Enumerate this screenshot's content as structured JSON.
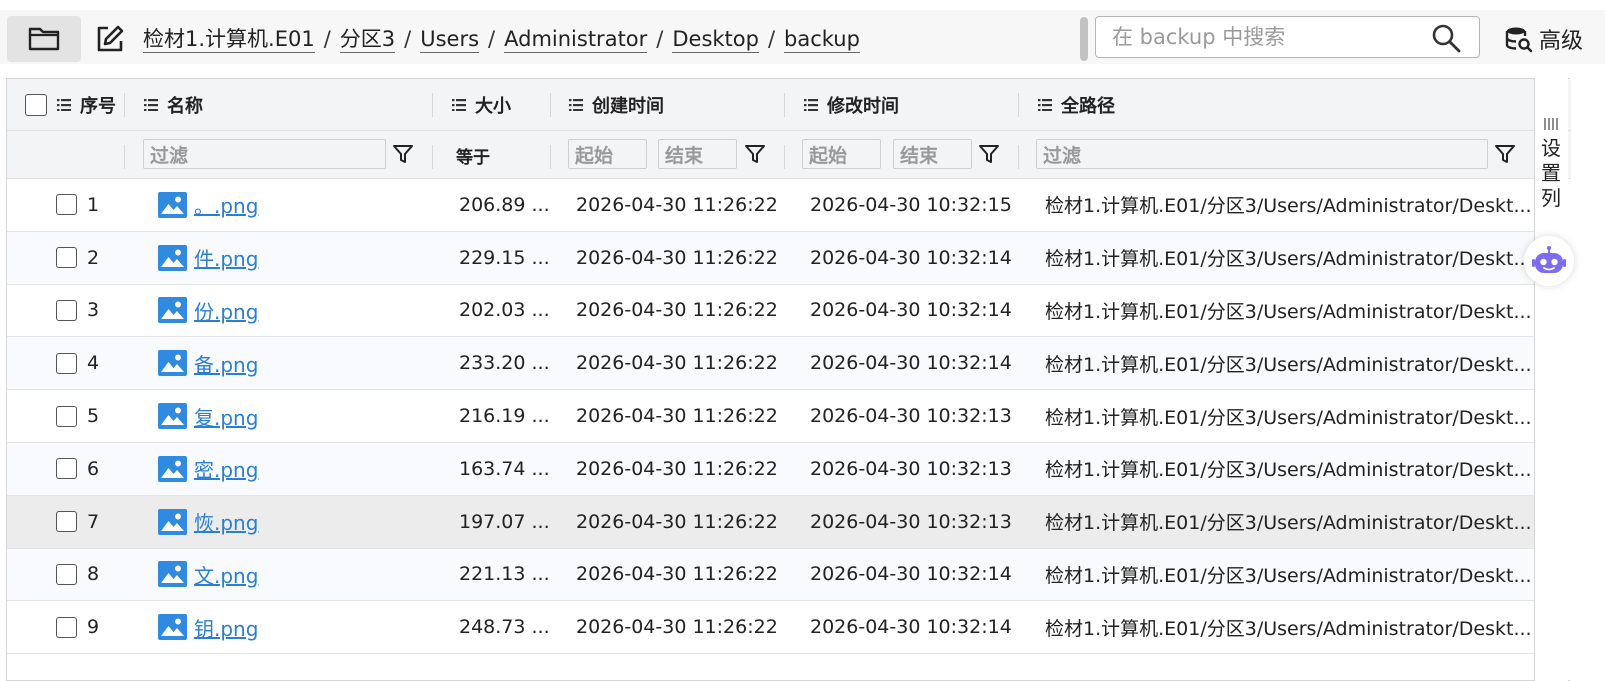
{
  "breadcrumb": [
    "检材1.计算机.E01",
    "分区3",
    "Users",
    "Administrator",
    "Desktop",
    "backup"
  ],
  "breadcrumb_separator": "/",
  "search": {
    "placeholder": "在 backup 中搜索"
  },
  "advanced_label": "高级",
  "columns": {
    "index": "序号",
    "name": "名称",
    "size": "大小",
    "created": "创建时间",
    "modified": "修改时间",
    "fullpath": "全路径"
  },
  "filters": {
    "name_placeholder": "过滤",
    "size_operator": "等于",
    "created_start": "起始",
    "created_end": "结束",
    "modified_start": "起始",
    "modified_end": "结束",
    "fullpath_placeholder": "过滤"
  },
  "rows": [
    {
      "index": "1",
      "name": "。.png",
      "size": "206.89 ...",
      "created": "2026-04-30 11:26:22",
      "modified": "2026-04-30 10:32:15",
      "fullpath": "检材1.计算机.E01/分区3/Users/Administrator/Deskt..."
    },
    {
      "index": "2",
      "name": "件.png",
      "size": "229.15 ...",
      "created": "2026-04-30 11:26:22",
      "modified": "2026-04-30 10:32:14",
      "fullpath": "检材1.计算机.E01/分区3/Users/Administrator/Deskt..."
    },
    {
      "index": "3",
      "name": "份.png",
      "size": "202.03 ...",
      "created": "2026-04-30 11:26:22",
      "modified": "2026-04-30 10:32:14",
      "fullpath": "检材1.计算机.E01/分区3/Users/Administrator/Deskt..."
    },
    {
      "index": "4",
      "name": "备.png",
      "size": "233.20 ...",
      "created": "2026-04-30 11:26:22",
      "modified": "2026-04-30 10:32:14",
      "fullpath": "检材1.计算机.E01/分区3/Users/Administrator/Deskt..."
    },
    {
      "index": "5",
      "name": "复.png",
      "size": "216.19 ...",
      "created": "2026-04-30 11:26:22",
      "modified": "2026-04-30 10:32:13",
      "fullpath": "检材1.计算机.E01/分区3/Users/Administrator/Deskt..."
    },
    {
      "index": "6",
      "name": "密.png",
      "size": "163.74 ...",
      "created": "2026-04-30 11:26:22",
      "modified": "2026-04-30 10:32:13",
      "fullpath": "检材1.计算机.E01/分区3/Users/Administrator/Deskt..."
    },
    {
      "index": "7",
      "name": "恢.png",
      "size": "197.07 ...",
      "created": "2026-04-30 11:26:22",
      "modified": "2026-04-30 10:32:13",
      "fullpath": "检材1.计算机.E01/分区3/Users/Administrator/Deskt..."
    },
    {
      "index": "8",
      "name": "文.png",
      "size": "221.13 ...",
      "created": "2026-04-30 11:26:22",
      "modified": "2026-04-30 10:32:14",
      "fullpath": "检材1.计算机.E01/分区3/Users/Administrator/Deskt..."
    },
    {
      "index": "9",
      "name": "钥.png",
      "size": "248.73 ...",
      "created": "2026-04-30 11:26:22",
      "modified": "2026-04-30 10:32:14",
      "fullpath": "检材1.计算机.E01/分区3/Users/Administrator/Deskt..."
    }
  ],
  "highlighted_row": 7,
  "side_panel_label": "设置列",
  "colors": {
    "link": "#2a7fd4",
    "image_icon": "#2f8ae0",
    "bot_icon": "#7b6cf0"
  }
}
